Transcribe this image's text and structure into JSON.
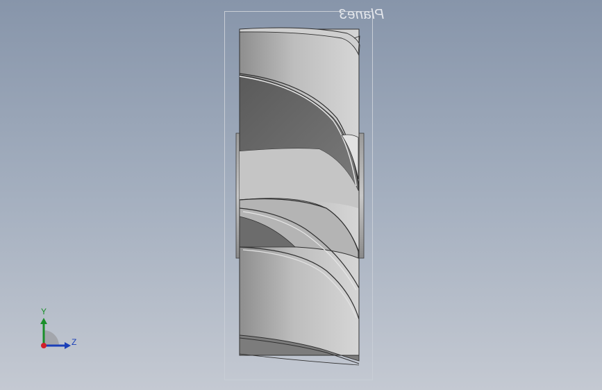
{
  "viewport": {
    "plane_label": "Plane3"
  },
  "triad": {
    "y_label": "Y",
    "z_label": "Z",
    "colors": {
      "y_axis": "#1a8f2a",
      "z_axis": "#1a3fb8",
      "x_axis": "#d0202a"
    }
  }
}
